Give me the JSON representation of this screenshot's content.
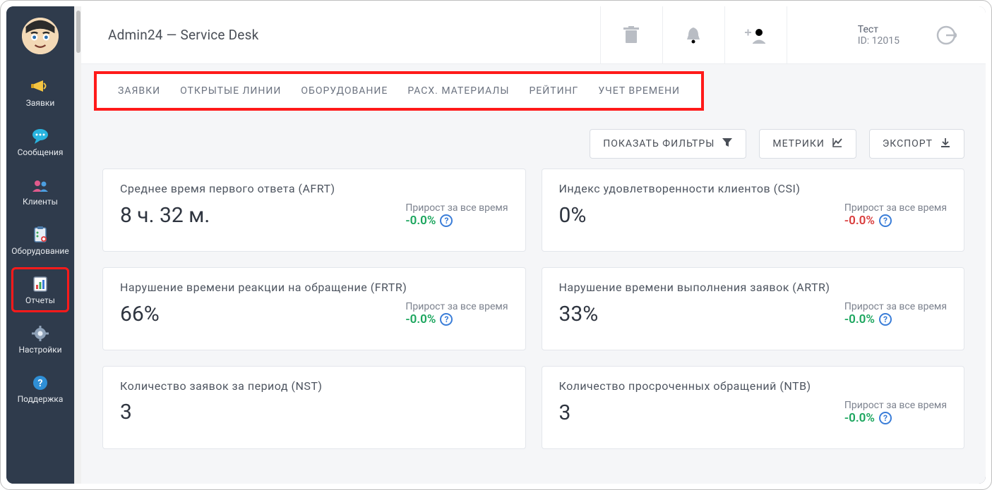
{
  "sidebar": {
    "items": [
      {
        "label": "Заявки",
        "icon": "megaphone-icon"
      },
      {
        "label": "Сообщения",
        "icon": "chat-icon"
      },
      {
        "label": "Клиенты",
        "icon": "people-icon"
      },
      {
        "label": "Оборудование",
        "icon": "clipboard-icon"
      },
      {
        "label": "Отчеты",
        "icon": "report-icon"
      },
      {
        "label": "Настройки",
        "icon": "gear-icon"
      },
      {
        "label": "Поддержка",
        "icon": "help-icon"
      }
    ]
  },
  "header": {
    "title": "Admin24 — Service Desk",
    "user_name": "Тест",
    "user_id": "ID: 12015"
  },
  "tabs": [
    "ЗАЯВКИ",
    "ОТКРЫТЫЕ ЛИНИИ",
    "ОБОРУДОВАНИЕ",
    "РАСХ. МАТЕРИАЛЫ",
    "РЕЙТИНГ",
    "УЧЕТ ВРЕМЕНИ"
  ],
  "actions": {
    "filters": "ПОКАЗАТЬ ФИЛЬТРЫ",
    "metrics": "МЕТРИКИ",
    "export": "ЭКСПОРТ"
  },
  "growth_label": "Прирост за все время",
  "cards": [
    {
      "title": "Среднее время первого ответа (AFRT)",
      "value": "8 ч. 32 м.",
      "growth": "-0.0%",
      "growth_color": "green"
    },
    {
      "title": "Индекс удовлетворенности клиентов (CSI)",
      "value": "0%",
      "growth": "-0.0%",
      "growth_color": "red"
    },
    {
      "title": "Нарушение времени реакции на обращение (FRTR)",
      "value": "66%",
      "growth": "-0.0%",
      "growth_color": "green"
    },
    {
      "title": "Нарушение времени выполнения заявок (ARTR)",
      "value": "33%",
      "growth": "-0.0%",
      "growth_color": "green"
    },
    {
      "title": "Количество заявок за период (NST)",
      "value": "3",
      "growth": "",
      "growth_color": ""
    },
    {
      "title": "Количество просроченных обращений (NTB)",
      "value": "3",
      "growth": "-0.0%",
      "growth_color": "green"
    }
  ]
}
